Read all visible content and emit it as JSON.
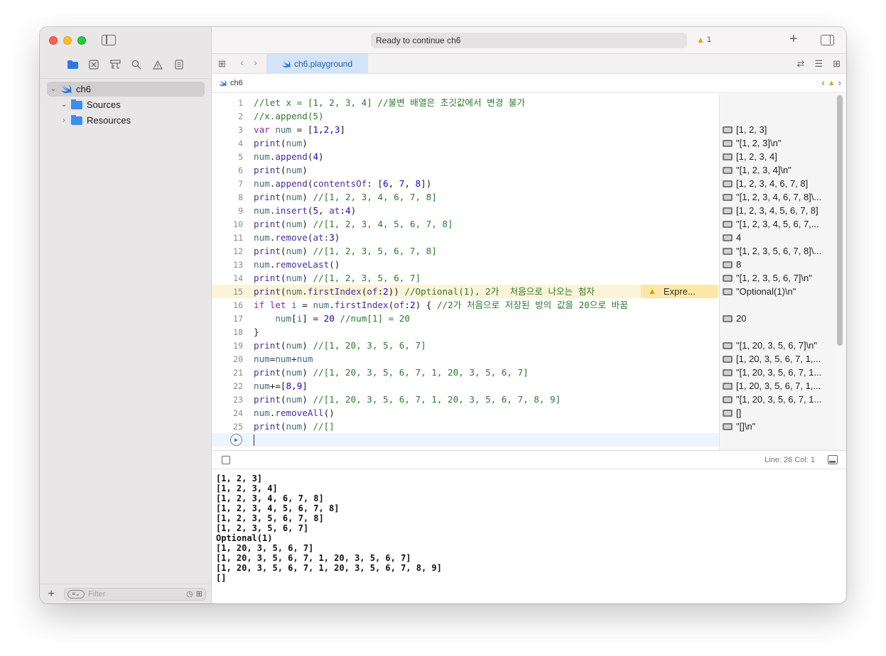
{
  "window": {
    "title": "Ready to continue ch6",
    "warning_count": "1"
  },
  "sidebar": {
    "nav_icons": [
      "folder-icon",
      "x-square-icon",
      "hierarchy-icon",
      "search-icon",
      "warning-icon",
      "list-icon"
    ],
    "tree": [
      {
        "label": "ch6",
        "expanded": true,
        "selected": true
      },
      {
        "label": "Sources",
        "expanded": true
      },
      {
        "label": "Resources",
        "expanded": false
      }
    ],
    "filter_placeholder": "Filter"
  },
  "tabs": [
    {
      "label": "ch6.playground",
      "active": true
    }
  ],
  "jumpbar": {
    "item": "ch6"
  },
  "editor": {
    "lines": [
      {
        "n": "1",
        "parts": [
          [
            "cm",
            "//let x = [1, 2, 3, 4] //불변 배열은 초깃값에서 변경 불가"
          ]
        ]
      },
      {
        "n": "2",
        "parts": [
          [
            "cm",
            "//x.append(5)"
          ]
        ]
      },
      {
        "n": "3",
        "parts": [
          [
            "kw",
            "var"
          ],
          [
            "pl",
            " "
          ],
          [
            "var",
            "num"
          ],
          [
            "pl",
            " = ["
          ],
          [
            "num",
            "1"
          ],
          [
            "pl",
            ","
          ],
          [
            "num",
            "2"
          ],
          [
            "pl",
            ","
          ],
          [
            "num",
            "3"
          ],
          [
            "pl",
            "]"
          ]
        ]
      },
      {
        "n": "4",
        "parts": [
          [
            "fn",
            "print"
          ],
          [
            "pl",
            "("
          ],
          [
            "var",
            "num"
          ],
          [
            "pl",
            ")"
          ]
        ]
      },
      {
        "n": "5",
        "parts": [
          [
            "var",
            "num"
          ],
          [
            "pl",
            "."
          ],
          [
            "fn",
            "append"
          ],
          [
            "pl",
            "("
          ],
          [
            "num",
            "4"
          ],
          [
            "pl",
            ")"
          ]
        ]
      },
      {
        "n": "6",
        "parts": [
          [
            "fn",
            "print"
          ],
          [
            "pl",
            "("
          ],
          [
            "var",
            "num"
          ],
          [
            "pl",
            ")"
          ]
        ]
      },
      {
        "n": "7",
        "parts": [
          [
            "var",
            "num"
          ],
          [
            "pl",
            "."
          ],
          [
            "fn",
            "append"
          ],
          [
            "pl",
            "("
          ],
          [
            "fn",
            "contentsOf"
          ],
          [
            "pl",
            ": ["
          ],
          [
            "num",
            "6"
          ],
          [
            "pl",
            ", "
          ],
          [
            "num",
            "7"
          ],
          [
            "pl",
            ", "
          ],
          [
            "num",
            "8"
          ],
          [
            "pl",
            "])"
          ]
        ]
      },
      {
        "n": "8",
        "parts": [
          [
            "fn",
            "print"
          ],
          [
            "pl",
            "("
          ],
          [
            "var",
            "num"
          ],
          [
            "pl",
            ") "
          ],
          [
            "cm",
            "//[1, 2, 3, 4, 6, 7, 8]"
          ]
        ]
      },
      {
        "n": "9",
        "parts": [
          [
            "var",
            "num"
          ],
          [
            "pl",
            "."
          ],
          [
            "fn",
            "insert"
          ],
          [
            "pl",
            "("
          ],
          [
            "num",
            "5"
          ],
          [
            "pl",
            ", "
          ],
          [
            "fn",
            "at"
          ],
          [
            "pl",
            ":"
          ],
          [
            "num",
            "4"
          ],
          [
            "pl",
            ")"
          ]
        ]
      },
      {
        "n": "10",
        "parts": [
          [
            "fn",
            "print"
          ],
          [
            "pl",
            "("
          ],
          [
            "var",
            "num"
          ],
          [
            "pl",
            ") "
          ],
          [
            "cm",
            "//[1, 2, 3, 4, 5, 6, 7, 8]"
          ]
        ]
      },
      {
        "n": "11",
        "parts": [
          [
            "var",
            "num"
          ],
          [
            "pl",
            "."
          ],
          [
            "fn",
            "remove"
          ],
          [
            "pl",
            "("
          ],
          [
            "fn",
            "at"
          ],
          [
            "pl",
            ":"
          ],
          [
            "num",
            "3"
          ],
          [
            "pl",
            ")"
          ]
        ]
      },
      {
        "n": "12",
        "parts": [
          [
            "fn",
            "print"
          ],
          [
            "pl",
            "("
          ],
          [
            "var",
            "num"
          ],
          [
            "pl",
            ") "
          ],
          [
            "cm",
            "//[1, 2, 3, 5, 6, 7, 8]"
          ]
        ]
      },
      {
        "n": "13",
        "parts": [
          [
            "var",
            "num"
          ],
          [
            "pl",
            "."
          ],
          [
            "fn",
            "removeLast"
          ],
          [
            "pl",
            "()"
          ]
        ]
      },
      {
        "n": "14",
        "parts": [
          [
            "fn",
            "print"
          ],
          [
            "pl",
            "("
          ],
          [
            "var",
            "num"
          ],
          [
            "pl",
            ") "
          ],
          [
            "cm",
            "//[1, 2, 3, 5, 6, 7]"
          ]
        ]
      },
      {
        "n": "15",
        "highlight": true,
        "parts": [
          [
            "fn",
            "print"
          ],
          [
            "pl",
            "("
          ],
          [
            "var",
            "num"
          ],
          [
            "pl",
            "."
          ],
          [
            "fn",
            "firstIndex"
          ],
          [
            "pl",
            "("
          ],
          [
            "fn",
            "of"
          ],
          [
            "pl",
            ":"
          ],
          [
            "num",
            "2"
          ],
          [
            "pl",
            ")) "
          ],
          [
            "cm",
            "//Optional(1), 2가  처음으로 나오는 첨자"
          ]
        ]
      },
      {
        "n": "16",
        "parts": [
          [
            "kw",
            "if let"
          ],
          [
            "pl",
            " "
          ],
          [
            "var",
            "i"
          ],
          [
            "pl",
            " = "
          ],
          [
            "var",
            "num"
          ],
          [
            "pl",
            "."
          ],
          [
            "fn",
            "firstIndex"
          ],
          [
            "pl",
            "("
          ],
          [
            "fn",
            "of"
          ],
          [
            "pl",
            ":"
          ],
          [
            "num",
            "2"
          ],
          [
            "pl",
            ") { "
          ],
          [
            "cm",
            "//2가 처음으로 저장된 방의 값을 20으로 바꿈"
          ]
        ]
      },
      {
        "n": "17",
        "parts": [
          [
            "pl",
            "    "
          ],
          [
            "var",
            "num"
          ],
          [
            "pl",
            "["
          ],
          [
            "var",
            "i"
          ],
          [
            "pl",
            "] = "
          ],
          [
            "num",
            "20"
          ],
          [
            "pl",
            " "
          ],
          [
            "cm",
            "//num[1] = 20"
          ]
        ]
      },
      {
        "n": "18",
        "parts": [
          [
            "pl",
            "}"
          ]
        ]
      },
      {
        "n": "19",
        "parts": [
          [
            "fn",
            "print"
          ],
          [
            "pl",
            "("
          ],
          [
            "var",
            "num"
          ],
          [
            "pl",
            ") "
          ],
          [
            "cm",
            "//[1, 20, 3, 5, 6, 7]"
          ]
        ]
      },
      {
        "n": "20",
        "parts": [
          [
            "var",
            "num"
          ],
          [
            "pl",
            "="
          ],
          [
            "var",
            "num"
          ],
          [
            "pl",
            "+"
          ],
          [
            "var",
            "num"
          ]
        ]
      },
      {
        "n": "21",
        "parts": [
          [
            "fn",
            "print"
          ],
          [
            "pl",
            "("
          ],
          [
            "var",
            "num"
          ],
          [
            "pl",
            ") "
          ],
          [
            "cm",
            "//[1, 20, 3, 5, 6, 7, 1, 20, 3, 5, 6, 7]"
          ]
        ]
      },
      {
        "n": "22",
        "parts": [
          [
            "var",
            "num"
          ],
          [
            "pl",
            "+=["
          ],
          [
            "num",
            "8"
          ],
          [
            "pl",
            ","
          ],
          [
            "num",
            "9"
          ],
          [
            "pl",
            "]"
          ]
        ]
      },
      {
        "n": "23",
        "parts": [
          [
            "fn",
            "print"
          ],
          [
            "pl",
            "("
          ],
          [
            "var",
            "num"
          ],
          [
            "pl",
            ") "
          ],
          [
            "cm",
            "//[1, 20, 3, 5, 6, 7, 1, 20, 3, 5, 6, 7, 8, 9]"
          ]
        ]
      },
      {
        "n": "24",
        "parts": [
          [
            "var",
            "num"
          ],
          [
            "pl",
            "."
          ],
          [
            "fn",
            "removeAll"
          ],
          [
            "pl",
            "()"
          ]
        ]
      },
      {
        "n": "25",
        "parts": [
          [
            "fn",
            "print"
          ],
          [
            "pl",
            "("
          ],
          [
            "var",
            "num"
          ],
          [
            "pl",
            ") "
          ],
          [
            "cm",
            "//[]"
          ]
        ]
      }
    ],
    "warning_chip": "Expre..."
  },
  "results": [
    {
      "line": 3,
      "text": "[1, 2, 3]"
    },
    {
      "line": 4,
      "text": "\"[1, 2, 3]\\n\""
    },
    {
      "line": 5,
      "text": "[1, 2, 3, 4]"
    },
    {
      "line": 6,
      "text": "\"[1, 2, 3, 4]\\n\""
    },
    {
      "line": 7,
      "text": "[1, 2, 3, 4, 6, 7, 8]"
    },
    {
      "line": 8,
      "text": "\"[1, 2, 3, 4, 6, 7, 8]\\..."
    },
    {
      "line": 9,
      "text": "[1, 2, 3, 4, 5, 6, 7, 8]"
    },
    {
      "line": 10,
      "text": "\"[1, 2, 3, 4, 5, 6, 7,..."
    },
    {
      "line": 11,
      "text": "4"
    },
    {
      "line": 12,
      "text": "\"[1, 2, 3, 5, 6, 7, 8]\\..."
    },
    {
      "line": 13,
      "text": "8"
    },
    {
      "line": 14,
      "text": "\"[1, 2, 3, 5, 6, 7]\\n\""
    },
    {
      "line": 15,
      "text": "\"Optional(1)\\n\""
    },
    {
      "line": 17,
      "text": "20"
    },
    {
      "line": 19,
      "text": "\"[1, 20, 3, 5, 6, 7]\\n\""
    },
    {
      "line": 20,
      "text": "[1, 20, 3, 5, 6, 7, 1,..."
    },
    {
      "line": 21,
      "text": "\"[1, 20, 3, 5, 6, 7, 1..."
    },
    {
      "line": 22,
      "text": "[1, 20, 3, 5, 6, 7, 1,..."
    },
    {
      "line": 23,
      "text": "\"[1, 20, 3, 5, 6, 7, 1..."
    },
    {
      "line": 24,
      "text": "[]"
    },
    {
      "line": 25,
      "text": "\"[]\\n\""
    }
  ],
  "status": {
    "line_col": "Line: 26  Col: 1"
  },
  "console": {
    "lines": [
      "[1, 2, 3]",
      "[1, 2, 3, 4]",
      "[1, 2, 3, 4, 6, 7, 8]",
      "[1, 2, 3, 4, 5, 6, 7, 8]",
      "[1, 2, 3, 5, 6, 7, 8]",
      "[1, 2, 3, 5, 6, 7]",
      "Optional(1)",
      "[1, 20, 3, 5, 6, 7]",
      "[1, 20, 3, 5, 6, 7, 1, 20, 3, 5, 6, 7]",
      "[1, 20, 3, 5, 6, 7, 1, 20, 3, 5, 6, 7, 8, 9]",
      "[]"
    ]
  },
  "colors": {
    "accent": "#2b78e4",
    "warning": "#e6a800",
    "highlight_line": "#fbf4d8"
  }
}
